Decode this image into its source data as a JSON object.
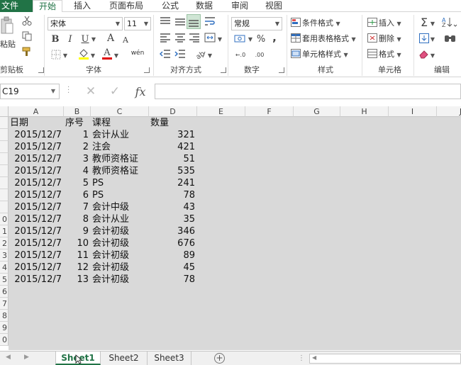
{
  "ribbon_tabs": {
    "file": "文件",
    "home": "开始",
    "insert": "插入",
    "page_layout": "页面布局",
    "formulas": "公式",
    "data": "数据",
    "review": "审阅",
    "view": "视图"
  },
  "clipboard": {
    "paste_label": "粘贴",
    "group_label": "剪贴板"
  },
  "font": {
    "name": "宋体",
    "size": "11",
    "bold": "B",
    "italic": "I",
    "underline": "U",
    "grow": "A",
    "shrink": "A",
    "color_letter": "A",
    "wen": "wén",
    "group_label": "字体"
  },
  "alignment": {
    "group_label": "对齐方式"
  },
  "number": {
    "format": "常规",
    "percent": "%",
    "comma": ",",
    "inc_decimal": "←.0",
    "dec_decimal": ".00",
    "group_label": "数字"
  },
  "styles": {
    "conditional": "条件格式",
    "table_format": "套用表格格式",
    "cell_styles": "单元格样式",
    "group_label": "样式"
  },
  "cells_group": {
    "insert": "插入",
    "delete": "删除",
    "format": "格式",
    "group_label": "单元格"
  },
  "editing": {
    "sigma": "Σ",
    "group_label": "编辑"
  },
  "formula_bar": {
    "name_box": "C19",
    "fx": "fx",
    "formula": ""
  },
  "columns": [
    "A",
    "B",
    "C",
    "D",
    "E",
    "F",
    "G",
    "H",
    "I",
    "J"
  ],
  "row_numbers": [
    "",
    "",
    "",
    "",
    "",
    "",
    "",
    "",
    "0",
    "1",
    "2",
    "3",
    "4",
    "5",
    "6",
    "7",
    "8",
    "9",
    "0"
  ],
  "table": {
    "header": [
      "日期",
      "序号",
      "课程",
      "数量"
    ],
    "rows": [
      [
        "2015/12/7",
        "1",
        "会计从业",
        "321"
      ],
      [
        "2015/12/7",
        "2",
        "注会",
        "421"
      ],
      [
        "2015/12/7",
        "3",
        "教师资格证",
        "51"
      ],
      [
        "2015/12/7",
        "4",
        "教师资格证",
        "535"
      ],
      [
        "2015/12/7",
        "5",
        "PS",
        "241"
      ],
      [
        "2015/12/7",
        "6",
        "PS",
        "78"
      ],
      [
        "2015/12/7",
        "7",
        "会计中级",
        "43"
      ],
      [
        "2015/12/7",
        "8",
        "会计从业",
        "35"
      ],
      [
        "2015/12/7",
        "9",
        "会计初级",
        "346"
      ],
      [
        "2015/12/7",
        "10",
        "会计初级",
        "676"
      ],
      [
        "2015/12/7",
        "11",
        "会计初级",
        "89"
      ],
      [
        "2015/12/7",
        "12",
        "会计初级",
        "45"
      ],
      [
        "2015/12/7",
        "13",
        "会计初级",
        "78"
      ]
    ]
  },
  "sheets": [
    "Sheet1",
    "Sheet2",
    "Sheet3"
  ],
  "accent_color": "#217346"
}
